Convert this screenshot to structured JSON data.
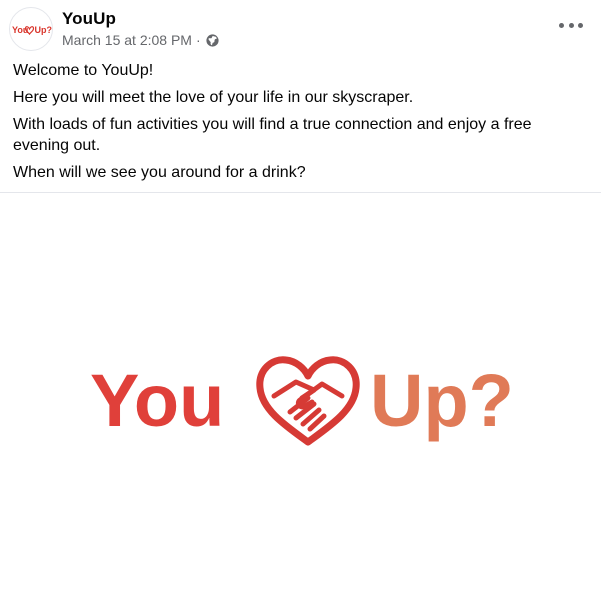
{
  "post": {
    "author": "YouUp",
    "timestamp": "March 15 at 2:08 PM",
    "separator": "·",
    "privacy_icon": "globe-icon",
    "more_icon": "more-horizontal-icon",
    "avatar_text": "YouUp?",
    "paragraphs": [
      "Welcome to YouUp!",
      "Here you will meet the love of your life in our skyscraper.",
      "With loads of fun activities you will find a true connection and enjoy a free evening out.",
      "When will we see you around for a drink?"
    ]
  },
  "media": {
    "logo_left": "You",
    "logo_right": "Up?",
    "logo_icon": "heart-handshake-icon",
    "colors": {
      "red": "#e0403a",
      "orange": "#e07a57",
      "dark_red": "#c0282e"
    }
  }
}
